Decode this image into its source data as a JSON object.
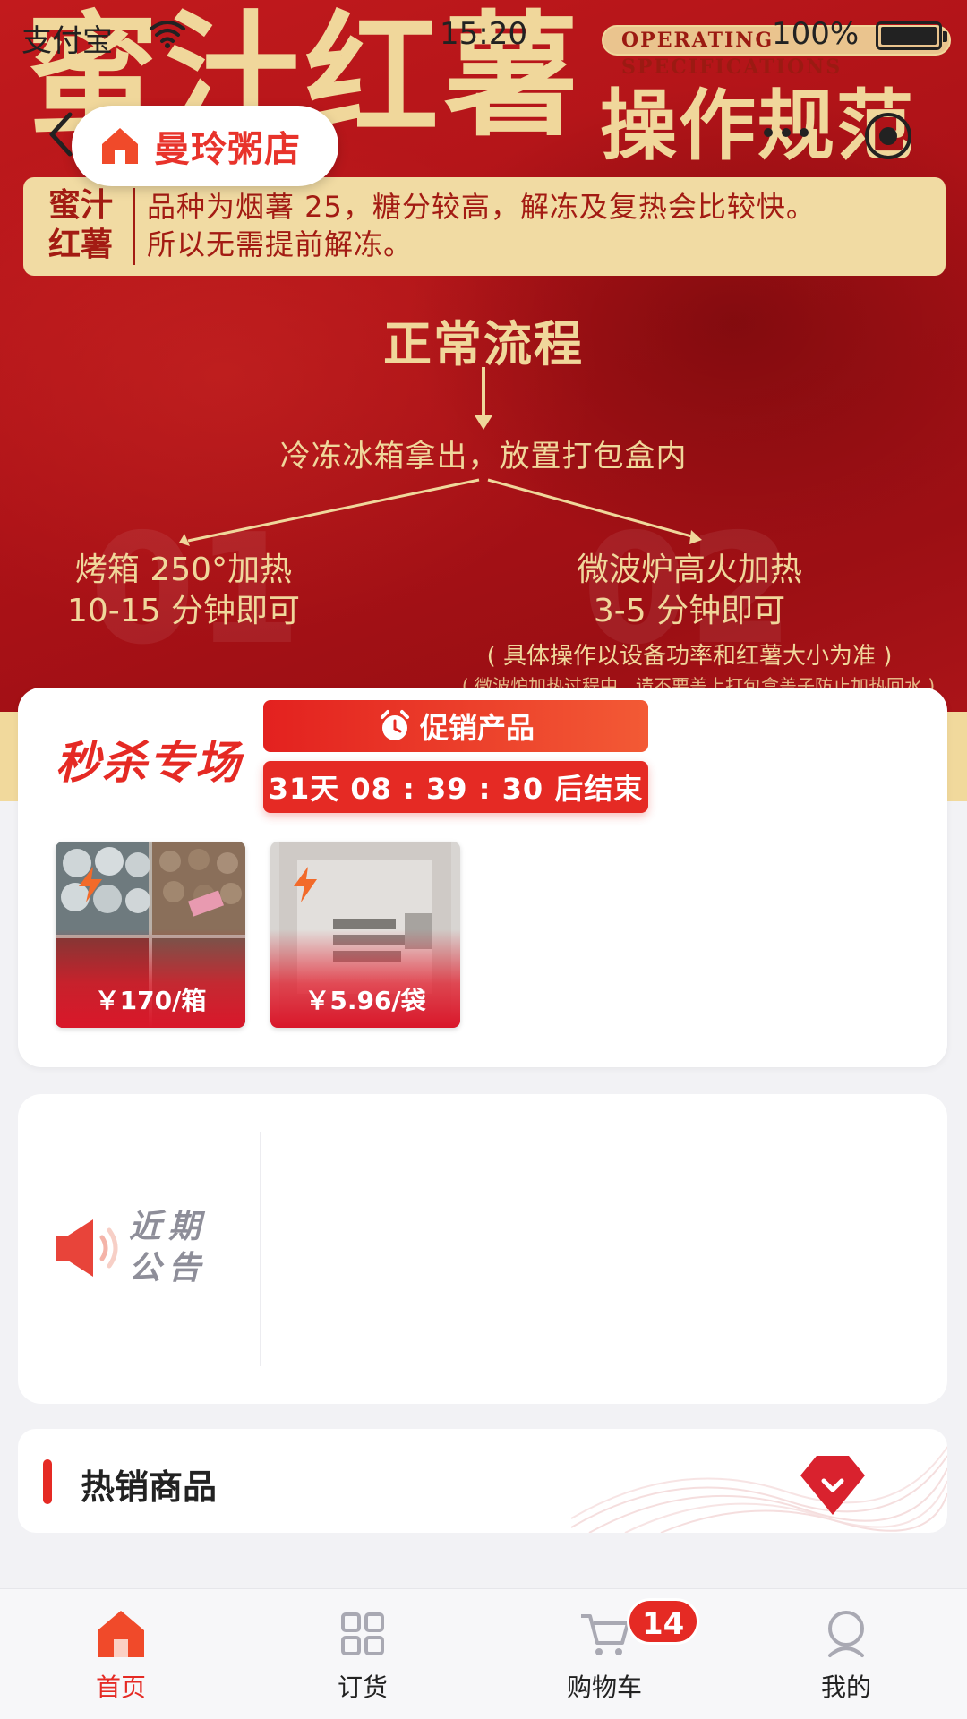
{
  "status_bar": {
    "carrier": "支付宝",
    "time": "15:20",
    "battery": "100%"
  },
  "nav": {
    "store_name": "曼玲粥店"
  },
  "banner": {
    "title": "蜜汁红薯",
    "subtitle": "操作规范",
    "tag": "OPERATING SPECIFICATIONS",
    "info_label_1": "蜜汁",
    "info_label_2": "红薯",
    "info_line_1": "品种为烟薯 25，糖分较高，解冻及复热会比较快。",
    "info_line_2": "所以无需提前解冻。",
    "flow_title": "正常流程",
    "flow_step": "冷冻冰箱拿出，放置打包盒内",
    "left_line_1": "烤箱 250°加热",
    "left_line_2": "10-15 分钟即可",
    "right_line_1": "微波炉高火加热",
    "right_line_2": "3-5 分钟即可",
    "note": "( 具体操作以设备功率和红薯大小为准 )",
    "note_2": "( 微波炉加热过程中，请不要盖上打包盒盖子防止加热回水 )",
    "ghost_left": "01",
    "ghost_right": "02"
  },
  "flash_sale": {
    "title": "秒杀专场",
    "promo_label": "促销产品",
    "countdown": "31天  08 : 39 : 30  后结束",
    "products": [
      {
        "price": "￥170/箱"
      },
      {
        "price": "￥5.96/袋"
      }
    ]
  },
  "notice": {
    "label_line_1": "近期",
    "label_line_2": "公告"
  },
  "hot": {
    "title": "热销商品"
  },
  "tabbar": {
    "items": [
      {
        "label": "首页"
      },
      {
        "label": "订货"
      },
      {
        "label": "购物车"
      },
      {
        "label": "我的"
      }
    ],
    "cart_badge": "14"
  },
  "colors": {
    "accent": "#e52a24",
    "banner_red": "#b1161a",
    "banner_gold": "#f0d79b"
  }
}
